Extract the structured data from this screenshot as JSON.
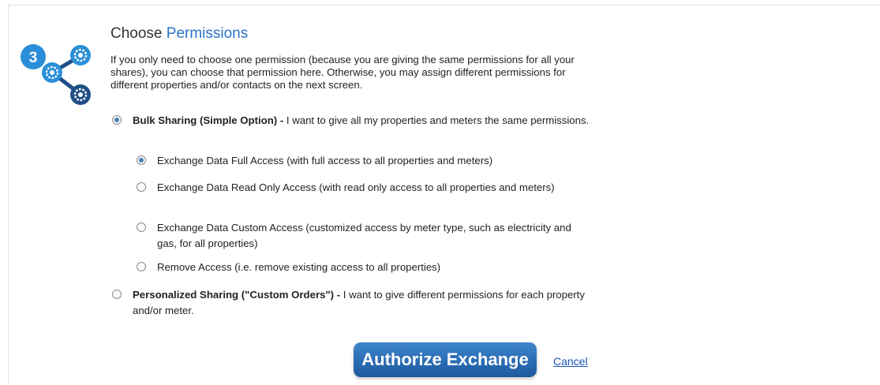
{
  "step": {
    "number": "3",
    "icon": "share-gears-icon",
    "colors": {
      "primary": "#2a8fd8",
      "dark": "#1f4f86"
    }
  },
  "title": {
    "prefix": "Choose",
    "accent": "Permissions",
    "accent_color": "#2a73c7"
  },
  "intro": "If you only need to choose one permission (because you are giving the same permissions for all your shares), you can choose that permission here. Otherwise, you may assign different permissions for different properties and/or contacts on the next screen.",
  "options": {
    "bulk": {
      "lead": "Bulk Sharing (Simple Option) -",
      "text": " I want to give all my properties and meters the same permissions.",
      "selected": true
    },
    "sub_options": [
      {
        "label": "Exchange Data Full Access (with full access to all properties and meters)",
        "selected": true
      },
      {
        "label": "Exchange Data Read Only Access (with read only access to all properties and meters)",
        "selected": false
      },
      {
        "label": "Exchange Data Custom Access (customized access by meter type, such as electricity and gas, for all properties)",
        "selected": false
      },
      {
        "label": "Remove Access (i.e. remove existing access to all properties)",
        "selected": false
      }
    ],
    "personalized": {
      "lead": "Personalized Sharing (\"Custom Orders\") -",
      "text": " I want to give different permissions for each property and/or meter.",
      "selected": false
    }
  },
  "actions": {
    "authorize_label": "Authorize Exchange",
    "cancel_label": "Cancel",
    "button_color": "#2a6cb4"
  }
}
